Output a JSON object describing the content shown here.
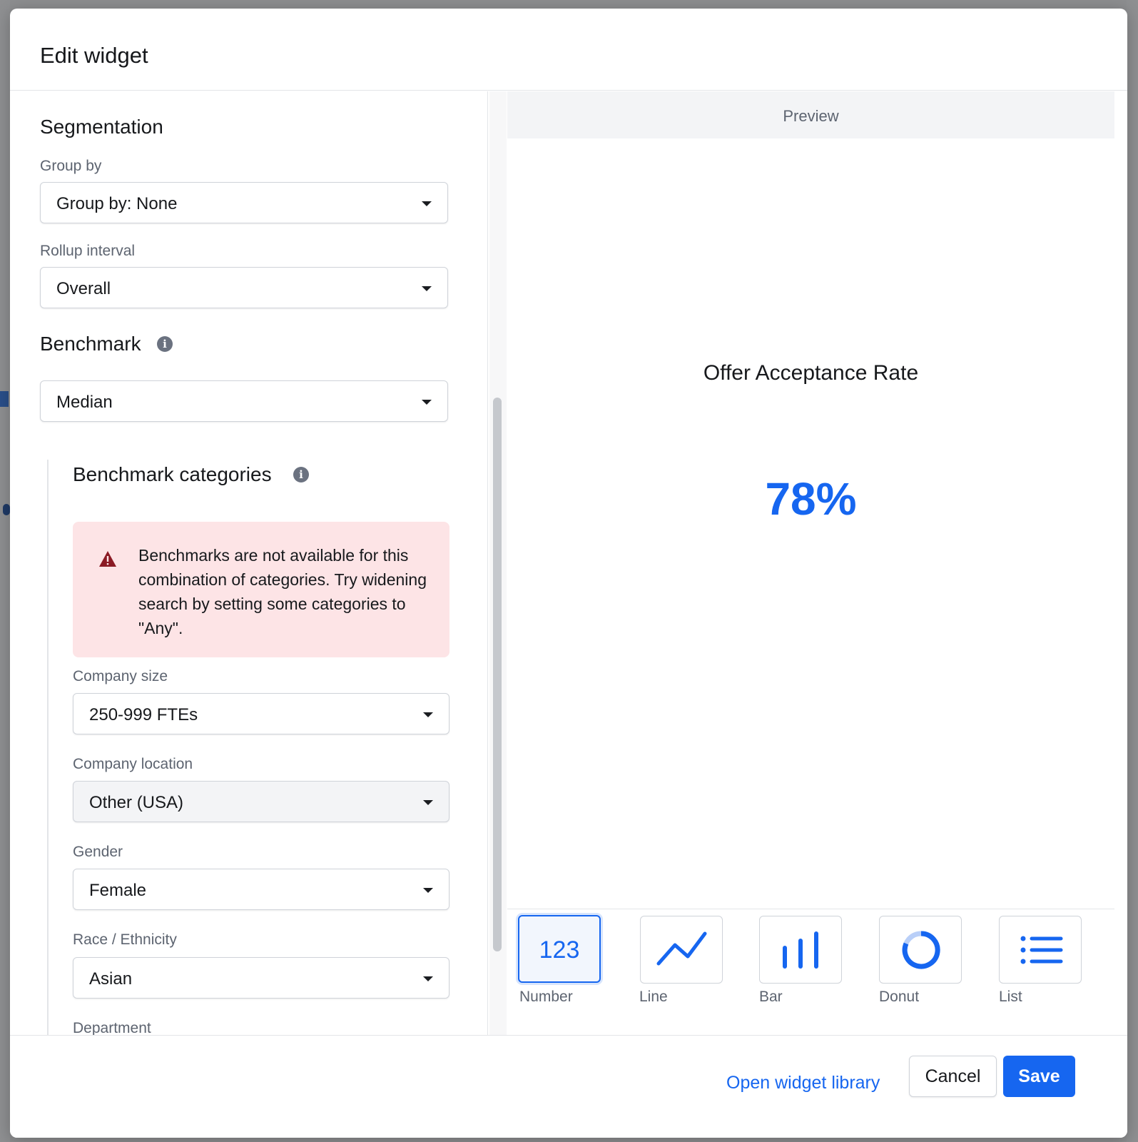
{
  "modal": {
    "title": "Edit widget"
  },
  "segmentation": {
    "title": "Segmentation",
    "group_by": {
      "label": "Group by",
      "value": "Group by: None"
    },
    "rollup_interval": {
      "label": "Rollup interval",
      "value": "Overall"
    }
  },
  "benchmark": {
    "title": "Benchmark",
    "value": "Median",
    "categories_title": "Benchmark categories",
    "alert_text": "Benchmarks are not available for this combination of categories. Try widening search by setting some categories to \"Any\".",
    "company_size": {
      "label": "Company size",
      "value": "250-999 FTEs"
    },
    "company_location": {
      "label": "Company location",
      "value": "Other (USA)"
    },
    "gender": {
      "label": "Gender",
      "value": "Female"
    },
    "race": {
      "label": "Race / Ethnicity",
      "value": "Asian"
    },
    "department": {
      "label": "Department"
    }
  },
  "preview": {
    "header": "Preview",
    "widget_title": "Offer Acceptance Rate",
    "widget_value": "78%"
  },
  "viz_types": [
    {
      "label": "Number",
      "glyph": "123",
      "icon": "number-icon",
      "active": true
    },
    {
      "label": "Line",
      "icon": "line-chart-icon",
      "active": false
    },
    {
      "label": "Bar",
      "icon": "bar-chart-icon",
      "active": false
    },
    {
      "label": "Donut",
      "icon": "donut-chart-icon",
      "active": false
    },
    {
      "label": "List",
      "icon": "list-icon",
      "active": false
    }
  ],
  "footer": {
    "library_link": "Open widget library",
    "cancel": "Cancel",
    "save": "Save"
  },
  "colors": {
    "accent": "#1666f0",
    "alert_bg": "#fde4e6",
    "alert_icon": "#8b1a24"
  }
}
